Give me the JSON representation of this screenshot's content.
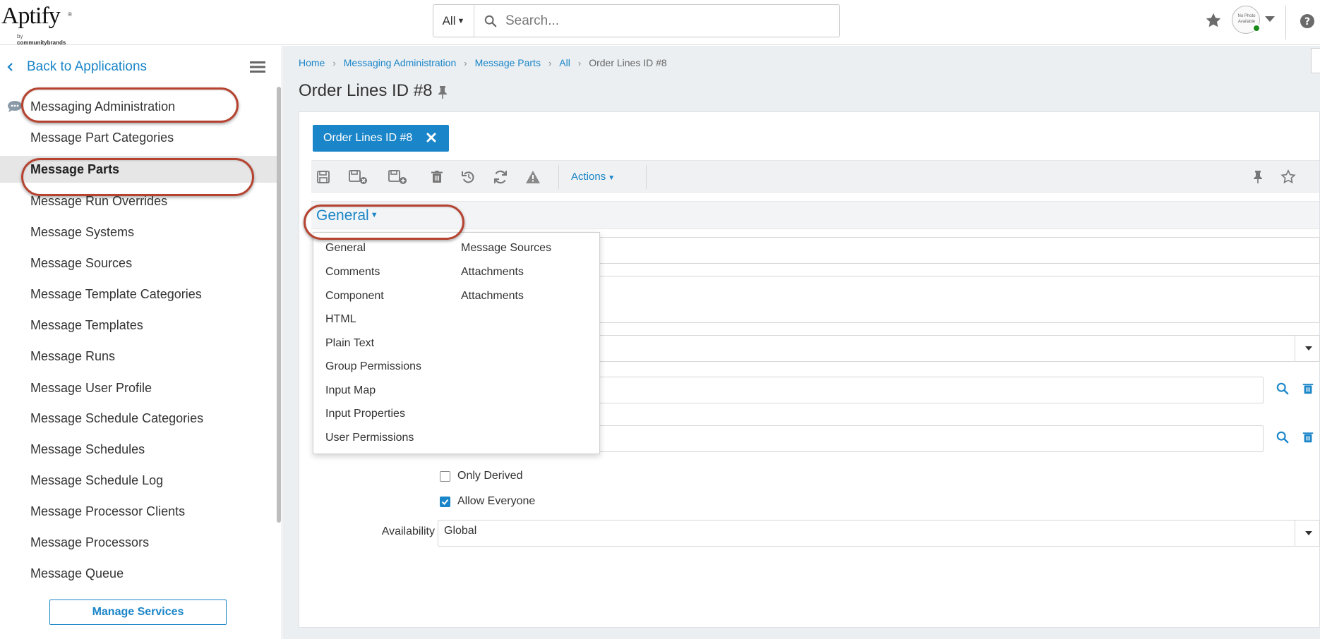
{
  "header": {
    "logo_text": "Aptify",
    "logo_reg": "®",
    "logo_sub_prefix": "by ",
    "logo_sub_brand": "communitybrands",
    "search_scope": "All",
    "search_placeholder": "Search...",
    "avatar_text": "No Photo Available"
  },
  "sidebar": {
    "back_label": "Back to Applications",
    "items": [
      {
        "label": "Messaging Administration"
      },
      {
        "label": "Message Part Categories"
      },
      {
        "label": "Message Parts"
      },
      {
        "label": "Message Run Overrides"
      },
      {
        "label": "Message Systems"
      },
      {
        "label": "Message Sources"
      },
      {
        "label": "Message Template Categories"
      },
      {
        "label": "Message Templates"
      },
      {
        "label": "Message Runs"
      },
      {
        "label": "Message User Profile"
      },
      {
        "label": "Message Schedule Categories"
      },
      {
        "label": "Message Schedules"
      },
      {
        "label": "Message Schedule Log"
      },
      {
        "label": "Message Processor Clients"
      },
      {
        "label": "Message Processors"
      },
      {
        "label": "Message Queue"
      }
    ],
    "active_item": "Message Parts",
    "manage_label": "Manage Services"
  },
  "breadcrumb": [
    "Home",
    "Messaging Administration",
    "Message Parts",
    "All",
    "Order Lines ID #8"
  ],
  "page_title": "Order Lines ID #8",
  "record_tab": "Order Lines ID #8",
  "toolbar": {
    "actions_label": "Actions",
    "icons": [
      "save-icon",
      "save-close-icon",
      "save-new-icon",
      "delete-icon",
      "undo-icon",
      "refresh-icon",
      "warning-icon",
      "pin-icon",
      "favorite-star-icon"
    ]
  },
  "section": {
    "label": "General",
    "menu_col1": [
      "General",
      "Comments",
      "Component",
      "HTML",
      "Plain Text",
      "Group Permissions",
      "Input Map",
      "Input Properties",
      "User Permissions"
    ],
    "menu_col2": [
      "Message Sources",
      "Attachments",
      "Attachments"
    ]
  },
  "form": {
    "only_derived_label": "Only Derived",
    "only_derived_checked": false,
    "allow_everyone_label": "Allow Everyone",
    "allow_everyone_checked": true,
    "availability_label": "Availability",
    "availability_value": "Global"
  },
  "colors": {
    "accent": "#1a85c8",
    "annotation": "#b54330",
    "active_row": "#e6e6e6"
  }
}
